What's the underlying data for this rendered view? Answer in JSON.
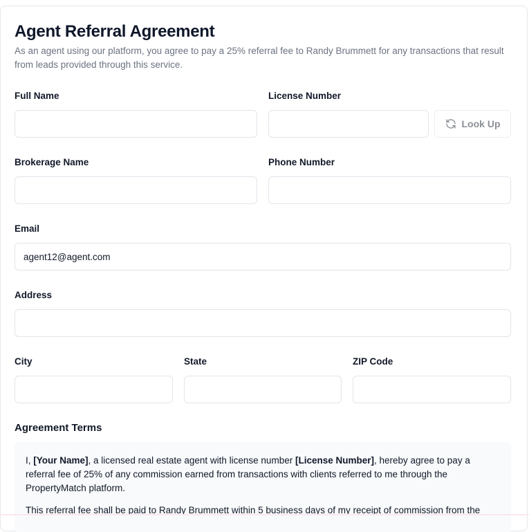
{
  "header": {
    "title": "Agent Referral Agreement",
    "description": "As an agent using our platform, you agree to pay a 25% referral fee to Randy Brummett for any transactions that result from leads provided through this service."
  },
  "form": {
    "full_name": {
      "label": "Full Name",
      "value": ""
    },
    "license_number": {
      "label": "License Number",
      "value": ""
    },
    "lookup_button": {
      "label": "Look Up",
      "icon": "refresh-icon"
    },
    "brokerage_name": {
      "label": "Brokerage Name",
      "value": ""
    },
    "phone_number": {
      "label": "Phone Number",
      "value": ""
    },
    "email": {
      "label": "Email",
      "value": "agent12@agent.com"
    },
    "address": {
      "label": "Address",
      "value": ""
    },
    "city": {
      "label": "City",
      "value": ""
    },
    "state": {
      "label": "State",
      "value": ""
    },
    "zip": {
      "label": "ZIP Code",
      "value": ""
    }
  },
  "terms": {
    "title": "Agreement Terms",
    "p1_prefix": "I, ",
    "p1_name": "[Your Name]",
    "p1_mid": ", a licensed real estate agent with license number ",
    "p1_license": "[License Number]",
    "p1_suffix": ", hereby agree to pay a referral fee of 25% of any commission earned from transactions with clients referred to me through the PropertyMatch platform.",
    "p2": "This referral fee shall be paid to Randy Brummett within 5 business days of my receipt of commission from the"
  },
  "colors": {
    "border": "#e2e5ea",
    "muted_text": "#6b7280",
    "terms_bg": "#f8fafc",
    "button_text": "#8b8f96"
  }
}
